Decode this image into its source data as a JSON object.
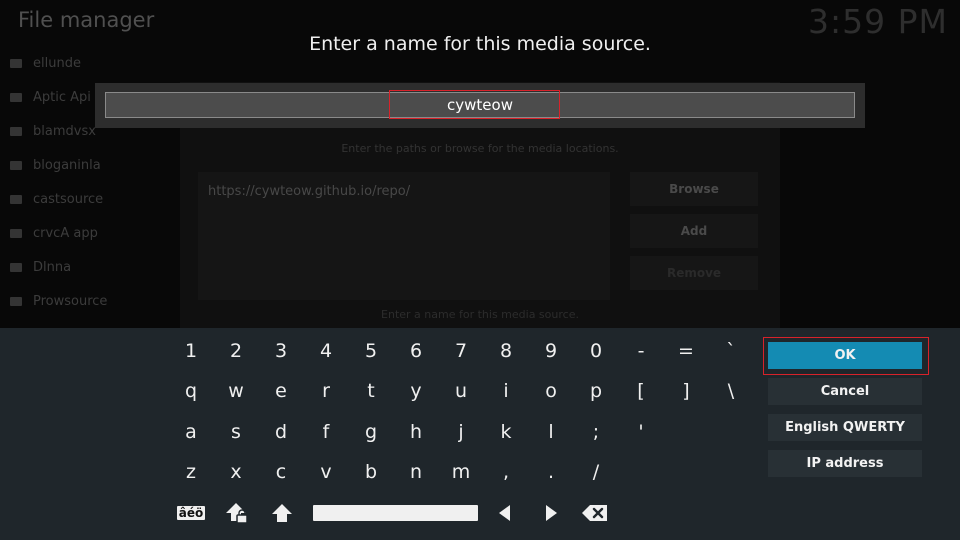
{
  "background": {
    "app_title": "File manager",
    "clock": "3:59 PM",
    "sources": [
      "ellunde",
      "Aptic Api",
      "blamdvsx",
      "bloganinla",
      "castsource",
      "crvcA app",
      "Dlnna",
      "Prowsource"
    ],
    "dialog": {
      "paths_label": "Enter the paths or browse for the media locations.",
      "path_value": "https://cywteow.github.io/repo/",
      "browse_label": "Browse",
      "add_label": "Add",
      "remove_label": "Remove",
      "name_label": "Enter a name for this media source."
    }
  },
  "prompt": {
    "heading": "Enter a name for this media source.",
    "value": "cywteow"
  },
  "keyboard": {
    "rows": [
      [
        "1",
        "2",
        "3",
        "4",
        "5",
        "6",
        "7",
        "8",
        "9",
        "0",
        "-",
        "=",
        "`"
      ],
      [
        "q",
        "w",
        "e",
        "r",
        "t",
        "y",
        "u",
        "i",
        "o",
        "p",
        "[",
        "]",
        "\\"
      ],
      [
        "a",
        "s",
        "d",
        "f",
        "g",
        "h",
        "j",
        "k",
        "l",
        ";",
        "'"
      ],
      [
        "z",
        "x",
        "c",
        "v",
        "b",
        "n",
        "m",
        ",",
        ".",
        "/"
      ]
    ],
    "symbols_key_label": "âéö",
    "icons": {
      "symbols": "accented-characters-icon",
      "caps_lock": "caps-lock-icon",
      "shift": "shift-icon",
      "left": "arrow-left-icon",
      "right": "arrow-right-icon",
      "backspace": "backspace-icon"
    },
    "buttons": {
      "ok": "OK",
      "cancel": "Cancel",
      "layout": "English QWERTY",
      "ip": "IP address"
    }
  },
  "colors": {
    "accent": "#148bb3",
    "highlight_outline": "#d8222a",
    "keyboard_bg": "#1f262b"
  }
}
